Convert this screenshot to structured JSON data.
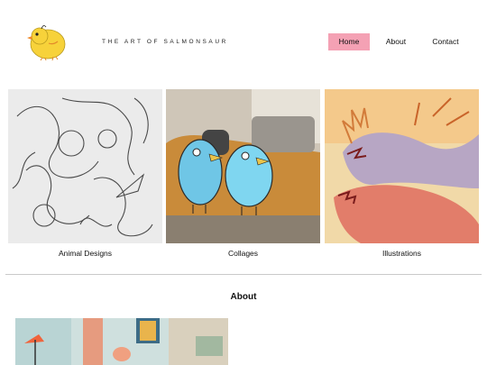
{
  "header": {
    "site_title": "THE ART OF SALMONSAUR",
    "logo_icon": "chick-logo-icon"
  },
  "nav": {
    "items": [
      {
        "label": "Home",
        "active": true
      },
      {
        "label": "About",
        "active": false
      },
      {
        "label": "Contact",
        "active": false
      }
    ],
    "active_color": "#f4a1b4"
  },
  "gallery": {
    "items": [
      {
        "label": "Animal Designs",
        "image": "sketch-drawing"
      },
      {
        "label": "Collages",
        "image": "birds-on-couch-collage"
      },
      {
        "label": "Illustrations",
        "image": "dragons-illustration"
      }
    ]
  },
  "about": {
    "heading": "About",
    "image": "interior-room-photo"
  }
}
